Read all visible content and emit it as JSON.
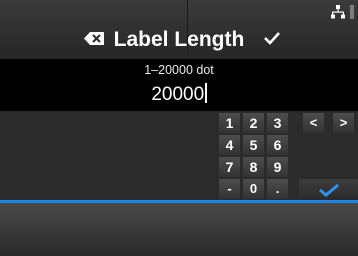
{
  "header": {
    "title": "Label Length",
    "network_icon": "network-icon"
  },
  "input": {
    "range_label": "1–20000 dot",
    "value": "20000"
  },
  "keypad": {
    "keys": [
      "1",
      "2",
      "3",
      "<",
      ">",
      "4",
      "5",
      "6",
      "7",
      "8",
      "9",
      "-",
      "0",
      "."
    ],
    "confirm_icon": "checkmark-icon"
  },
  "footer": {
    "left_icon": "backspace-icon",
    "right_icon": "checkmark-icon"
  },
  "colors": {
    "accent": "#1e86e6",
    "background": "#2a2a2a",
    "field_background": "#000000"
  }
}
